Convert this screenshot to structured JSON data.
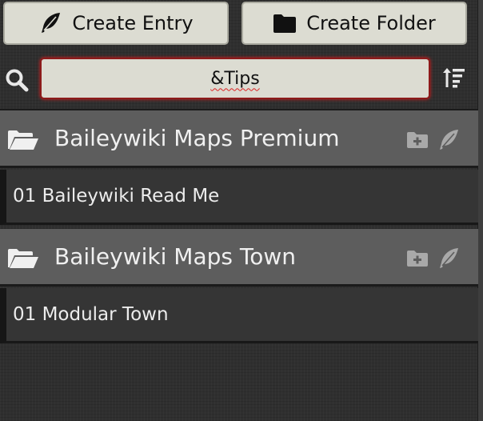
{
  "toolbar": {
    "create_entry_label": "Create Entry",
    "create_folder_label": "Create Folder"
  },
  "search": {
    "value": "&Tips"
  },
  "folders": [
    {
      "name": "Baileywiki Maps Premium",
      "entries": [
        {
          "label": "01 Baileywiki Read Me"
        }
      ]
    },
    {
      "name": "Baileywiki Maps Town",
      "entries": [
        {
          "label": "01 Modular Town"
        }
      ]
    }
  ],
  "colors": {
    "button_bg": "#dcdcd2",
    "folder_header_bg": "#5d5d5d",
    "entry_bg": "#353535",
    "search_focus_border": "#8d1a1a"
  },
  "icons": {
    "create_entry": "feather-icon",
    "create_folder": "folder-icon",
    "search": "search-icon",
    "sort": "sort-icon",
    "folder_open": "folder-open-icon",
    "folder_add": "folder-plus-icon",
    "entry_add": "feather-icon"
  }
}
